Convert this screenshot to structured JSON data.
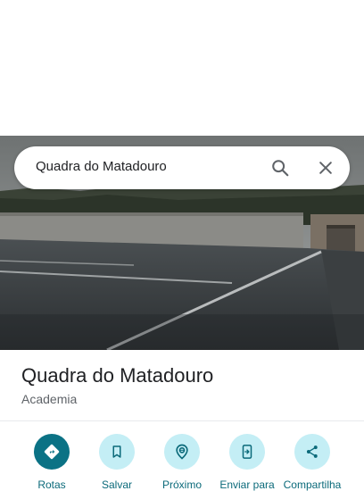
{
  "search": {
    "query": "Quadra do Matadouro",
    "search_icon": "search-icon",
    "close_icon": "close-icon"
  },
  "place": {
    "name": "Quadra do Matadouro",
    "category": "Academia"
  },
  "actions": [
    {
      "label": "Rotas",
      "icon": "directions-icon",
      "primary": true
    },
    {
      "label": "Salvar",
      "icon": "bookmark-icon",
      "primary": false
    },
    {
      "label": "Próximo",
      "icon": "nearby-icon",
      "primary": false
    },
    {
      "label": "Enviar para",
      "icon": "send-to-phone-icon",
      "primary": false
    },
    {
      "label": "Compartilha",
      "icon": "share-icon",
      "primary": false
    }
  ],
  "colors": {
    "accent": "#0b7285",
    "tonal": "#c4eef5",
    "label": "#0b6a7a"
  }
}
